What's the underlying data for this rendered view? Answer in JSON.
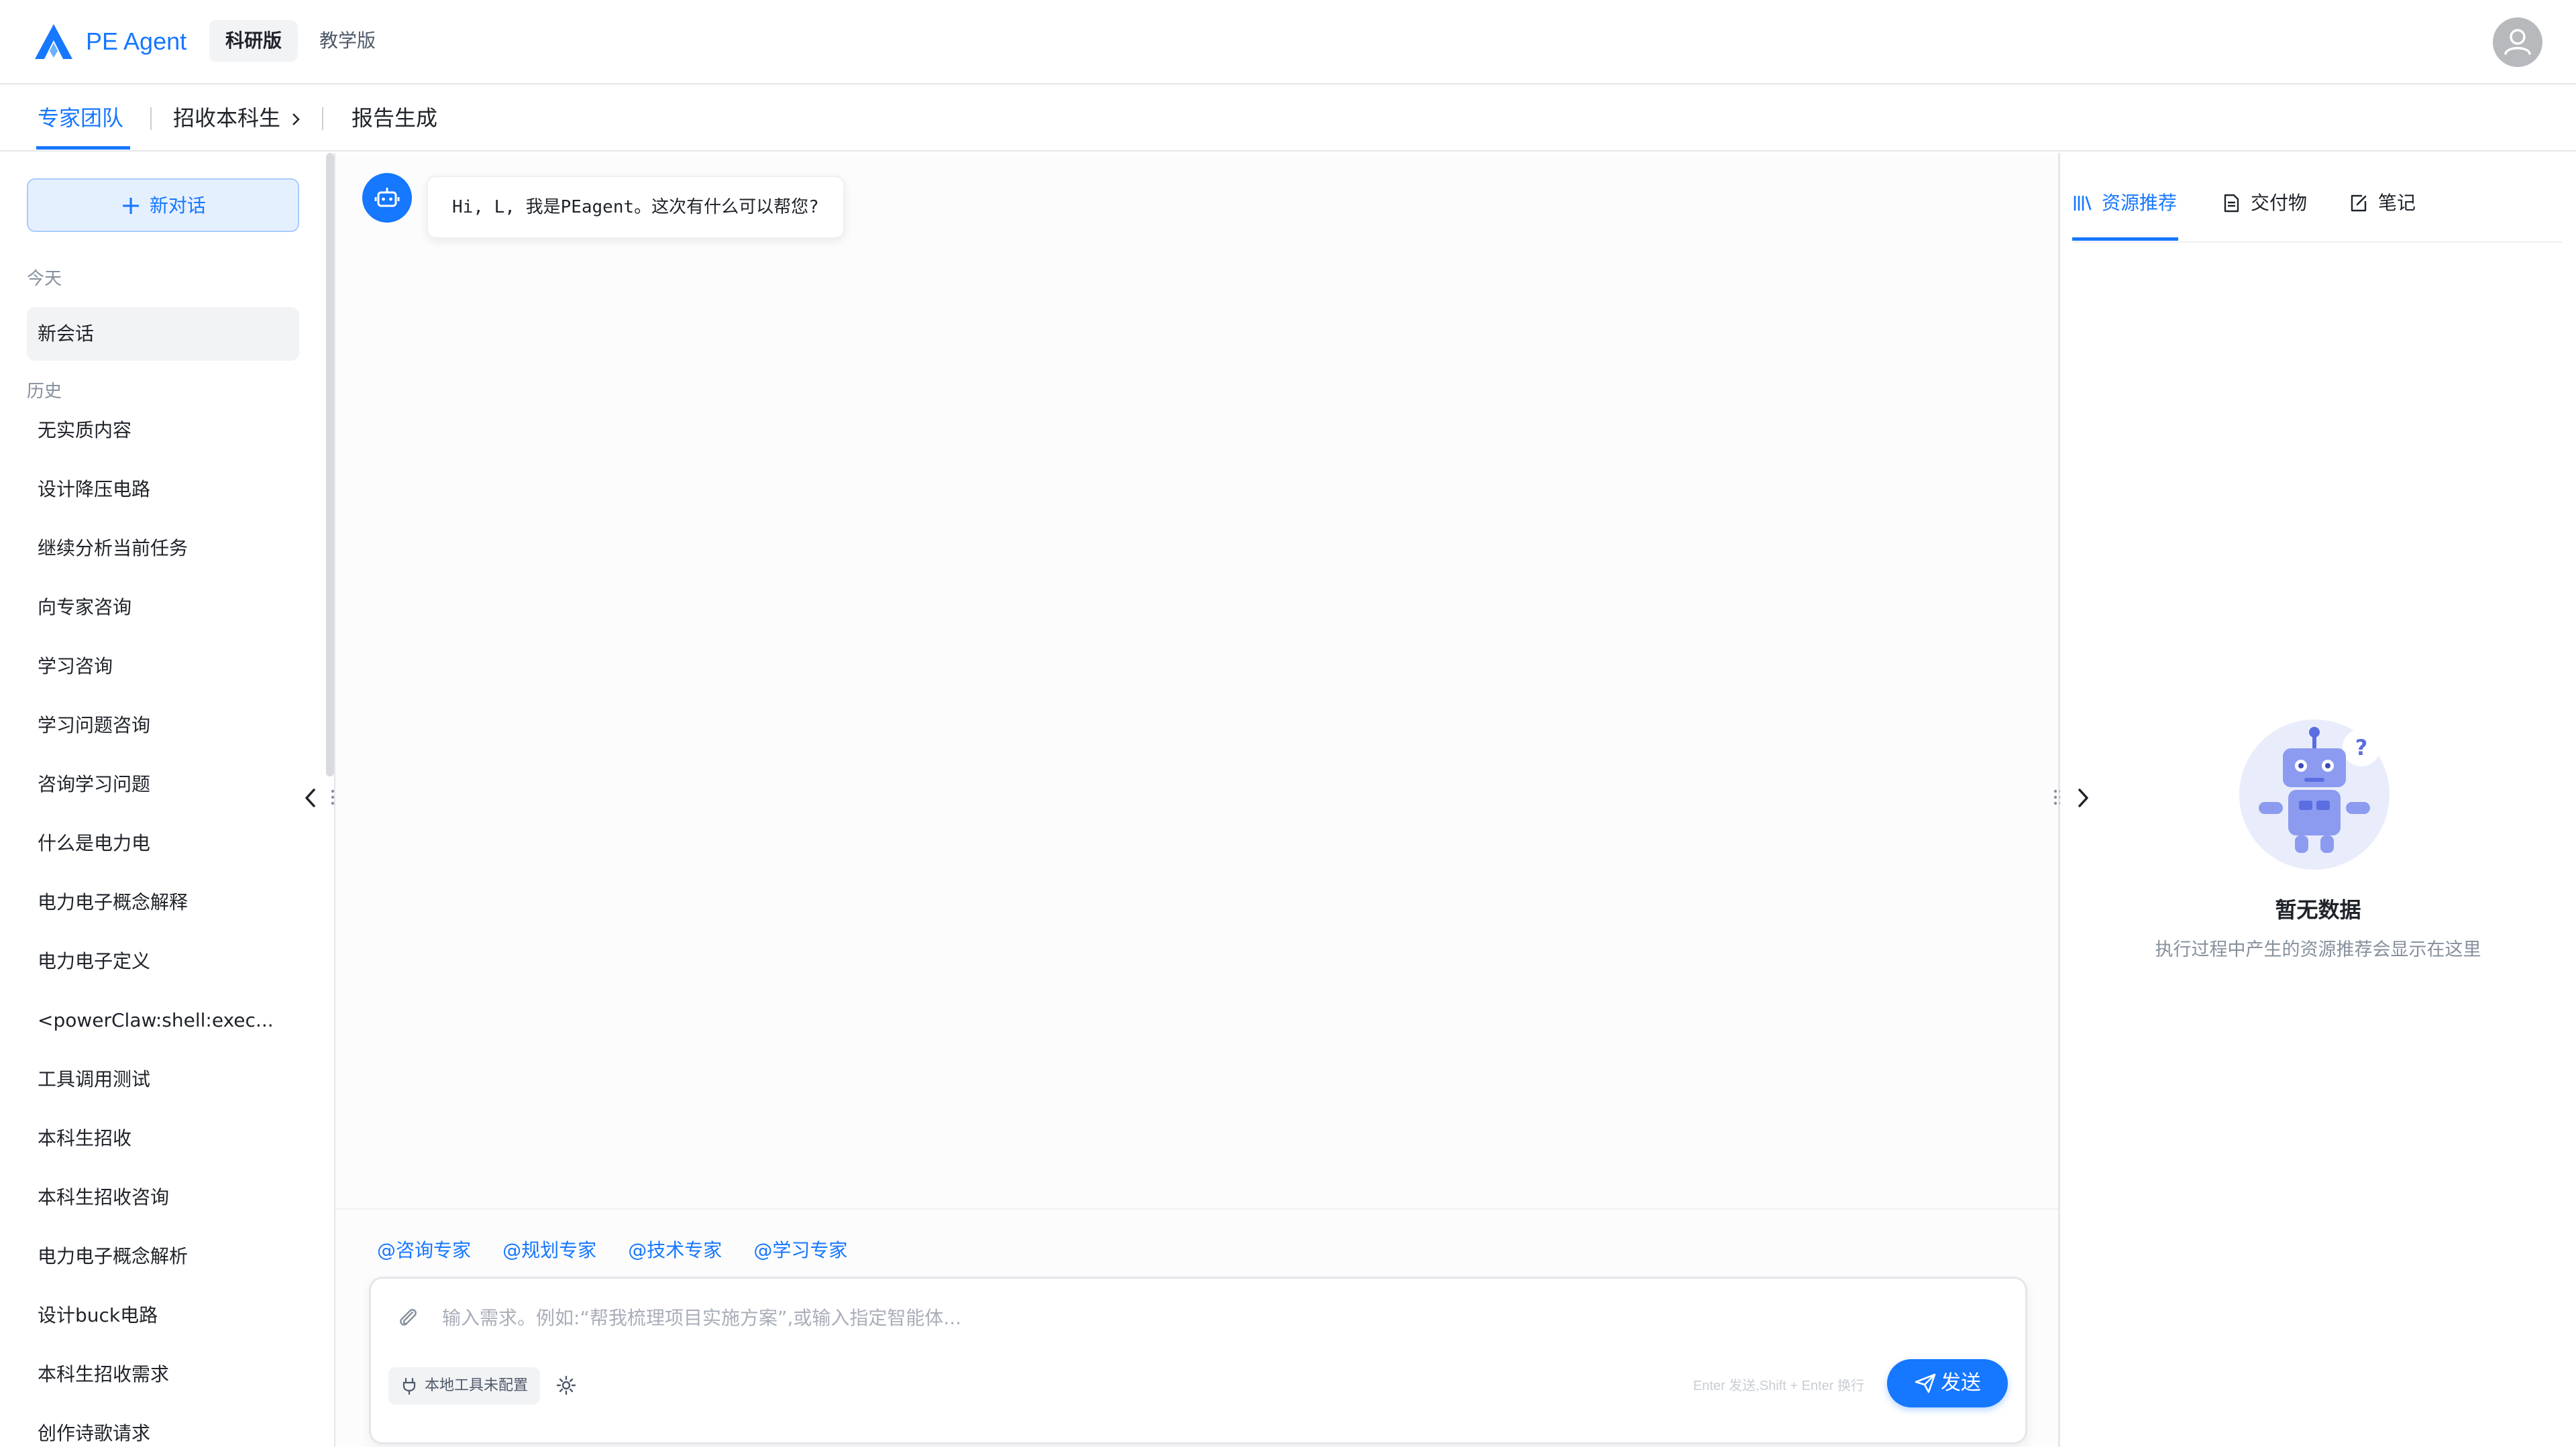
{
  "brand": {
    "name": "PE Agent"
  },
  "editions": {
    "research": "科研版",
    "teaching": "教学版"
  },
  "subnav": {
    "expert_team": "专家团队",
    "undergrad_admission": "招收本科生",
    "report": "报告生成"
  },
  "sidebar": {
    "new_chat_label": "新对话",
    "today_label": "今天",
    "active_session": "新会话",
    "history_label": "历史",
    "history": [
      "无实质内容",
      "设计降压电路",
      "继续分析当前任务",
      "向专家咨询",
      "学习咨询",
      "学习问题咨询",
      "咨询学习问题",
      "什么是电力电",
      "电力电子概念解释",
      "电力电子定义",
      "<powerClaw:shell:exec...",
      "工具调用测试",
      "本科生招收",
      "本科生招收咨询",
      "电力电子概念解析",
      "设计buck电路",
      "本科生招收需求",
      "创作诗歌请求"
    ]
  },
  "chat": {
    "greeting": "Hi, L, 我是PEagent。这次有什么可以帮您?",
    "mentions": [
      "@咨询专家",
      "@规划专家",
      "@技术专家",
      "@学习专家"
    ],
    "input_placeholder": "输入需求。例如:“帮我梳理项目实施方案”,或输入指定智能体...",
    "local_tools_label": "本地工具未配置",
    "send_hint": "Enter 发送,Shift + Enter 换行",
    "send_label": "发送"
  },
  "right_panel": {
    "tabs": [
      "资源推荐",
      "交付物",
      "笔记"
    ],
    "empty_title": "暂无数据",
    "empty_desc": "执行过程中产生的资源推荐会显示在这里"
  },
  "colors": {
    "accent": "#1677ff",
    "accent_light": "#e5f0ff"
  }
}
